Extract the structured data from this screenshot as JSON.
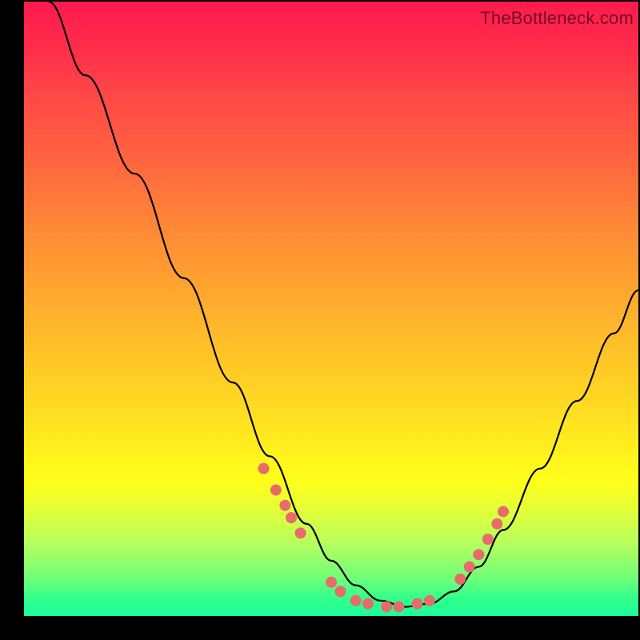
{
  "watermark": "TheBottleneck.com",
  "chart_data": {
    "type": "line",
    "title": "",
    "xlabel": "",
    "ylabel": "",
    "xlim": [
      0,
      100
    ],
    "ylim": [
      0,
      100
    ],
    "grid": false,
    "legend": false,
    "series": [
      {
        "name": "curve",
        "x": [
          4,
          10,
          18,
          26,
          34,
          40,
          46,
          50,
          54,
          58,
          62,
          66,
          70,
          74,
          78,
          84,
          90,
          96,
          100
        ],
        "y": [
          100,
          88,
          72,
          55,
          38,
          26,
          15,
          9,
          5,
          2.5,
          1.5,
          2,
          4,
          8,
          14,
          24,
          35,
          46,
          53
        ]
      }
    ],
    "markers": [
      {
        "x": 39,
        "y": 24
      },
      {
        "x": 41,
        "y": 20.5
      },
      {
        "x": 42.5,
        "y": 18
      },
      {
        "x": 43.5,
        "y": 16
      },
      {
        "x": 45,
        "y": 13.5
      },
      {
        "x": 50,
        "y": 5.5
      },
      {
        "x": 51.5,
        "y": 4
      },
      {
        "x": 54,
        "y": 2.5
      },
      {
        "x": 56,
        "y": 2
      },
      {
        "x": 59,
        "y": 1.5
      },
      {
        "x": 61,
        "y": 1.5
      },
      {
        "x": 64,
        "y": 2
      },
      {
        "x": 66,
        "y": 2.5
      },
      {
        "x": 71,
        "y": 6
      },
      {
        "x": 72.5,
        "y": 8
      },
      {
        "x": 74,
        "y": 10
      },
      {
        "x": 75.5,
        "y": 12.5
      },
      {
        "x": 77,
        "y": 15
      },
      {
        "x": 78,
        "y": 17
      }
    ],
    "marker_style": {
      "color": "#e86b6b",
      "radius": 7
    },
    "background_gradient": {
      "direction": "vertical",
      "stops": [
        {
          "pos": 0,
          "color": "#ff1a4d"
        },
        {
          "pos": 50,
          "color": "#ffbd2a"
        },
        {
          "pos": 80,
          "color": "#ffff1a"
        },
        {
          "pos": 100,
          "color": "#1aff99"
        }
      ]
    }
  }
}
